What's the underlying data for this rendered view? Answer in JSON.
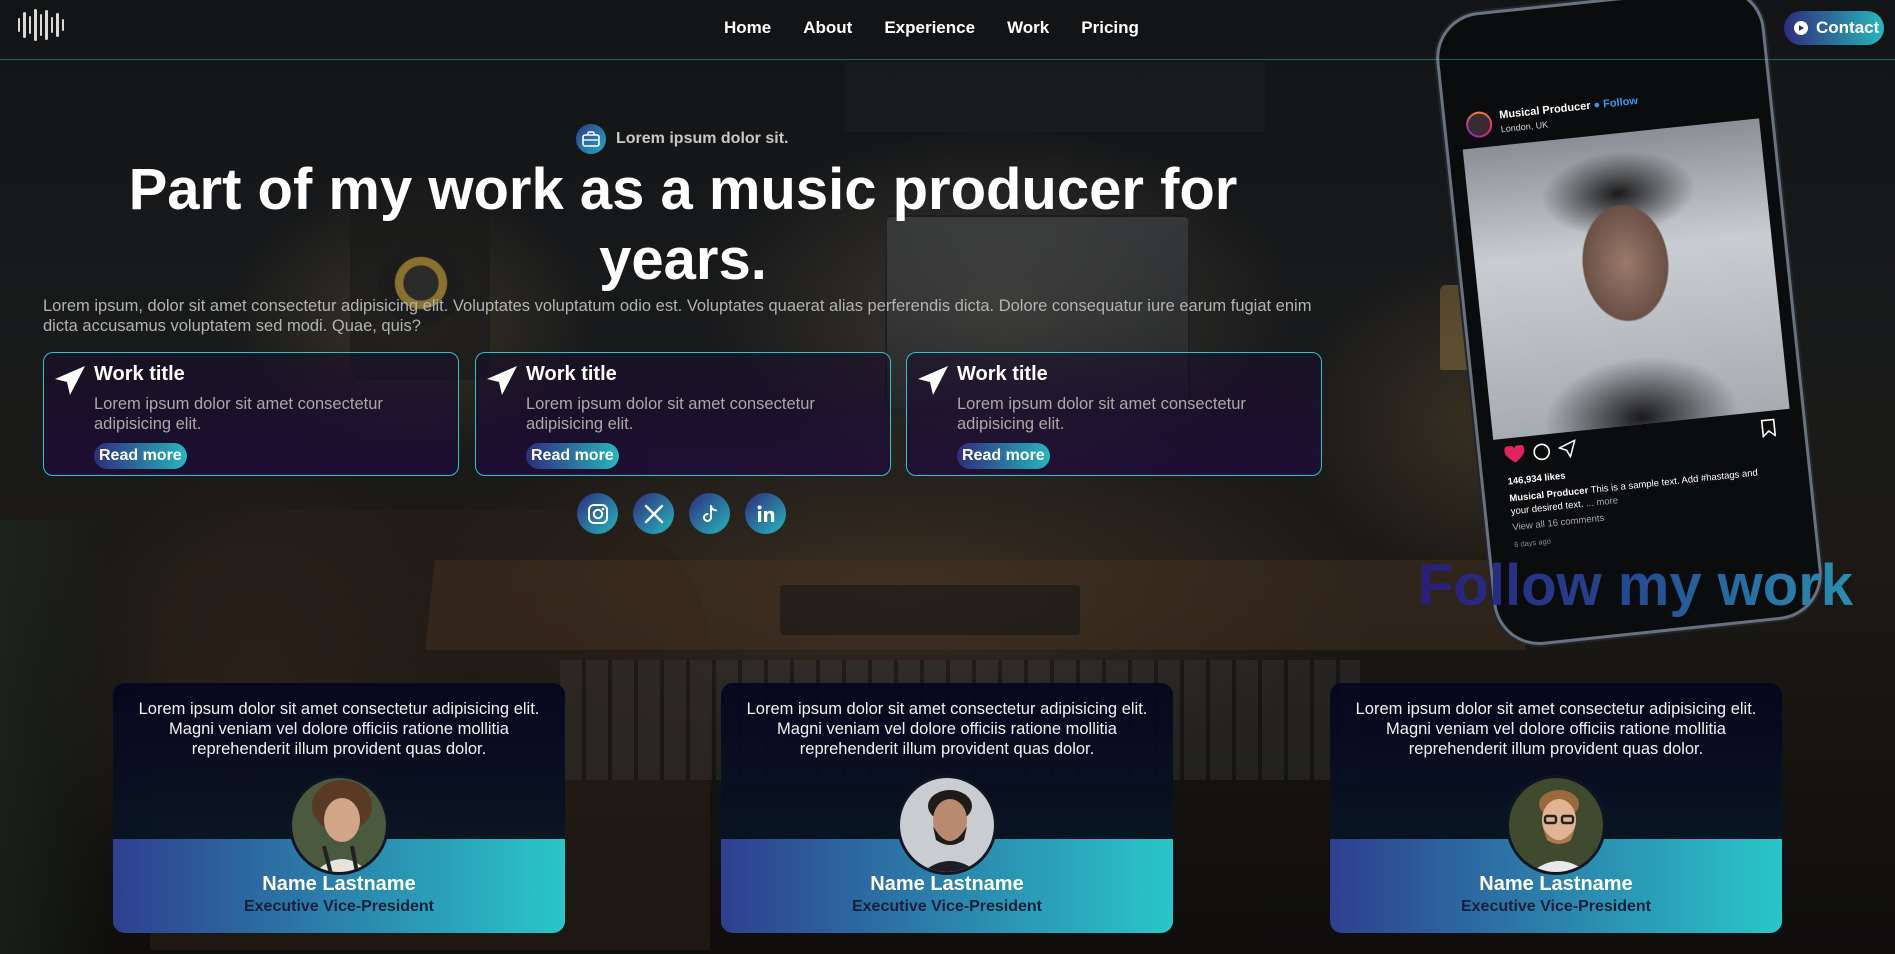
{
  "nav": {
    "items": [
      "Home",
      "About",
      "Experience",
      "Work",
      "Pricing"
    ],
    "contact_label": "Contact"
  },
  "hero": {
    "badge": "Lorem ipsum dolor sit.",
    "title": "Part of my work as a music producer for years.",
    "description": "Lorem ipsum, dolor sit amet consectetur adipisicing elit. Voluptates voluptatum odio est. Voluptates quaerat alias perferendis dicta. Dolore consequatur iure earum fugiat enim dicta accusamus voluptatem sed modi. Quae, quis?"
  },
  "works": [
    {
      "title": "Work title",
      "text": "Lorem ipsum dolor sit amet consectetur adipisicing elit.",
      "button": "Read more"
    },
    {
      "title": "Work title",
      "text": "Lorem ipsum dolor sit amet consectetur adipisicing elit.",
      "button": "Read more"
    },
    {
      "title": "Work title",
      "text": "Lorem ipsum dolor sit amet consectetur adipisicing elit.",
      "button": "Read more"
    }
  ],
  "socials": [
    "instagram-icon",
    "x-icon",
    "tiktok-icon",
    "linkedin-icon"
  ],
  "post": {
    "username": "Musical Producer",
    "follow": "Follow",
    "location": "London, UK",
    "likes": "146,934 likes",
    "caption_user": "Musical Producer",
    "caption_text": "This is a sample text. Add #hastags and your desired text.",
    "caption_more": "... more",
    "comments": "View all 16 comments",
    "time": "6 days ago"
  },
  "follow_title": "Follow my work",
  "testimonials": [
    {
      "quote": "Lorem ipsum dolor sit amet consectetur adipisicing elit. Magni veniam vel dolore officiis ratione mollitia reprehenderit illum provident quas dolor.",
      "name": "Name Lastname",
      "role": "Executive Vice-President"
    },
    {
      "quote": "Lorem ipsum dolor sit amet consectetur adipisicing elit. Magni veniam vel dolore officiis ratione mollitia reprehenderit illum provident quas dolor.",
      "name": "Name Lastname",
      "role": "Executive Vice-President"
    },
    {
      "quote": "Lorem ipsum dolor sit amet consectetur adipisicing elit. Magni veniam vel dolore officiis ratione mollitia reprehenderit illum provident quas dolor.",
      "name": "Name Lastname",
      "role": "Executive Vice-President"
    }
  ],
  "colors": {
    "accent_start": "#2f2d7c",
    "accent_end": "#27b6bd",
    "border": "#2fc1c9",
    "instagram_blue": "#3897f0",
    "like_red": "#e0245e"
  }
}
